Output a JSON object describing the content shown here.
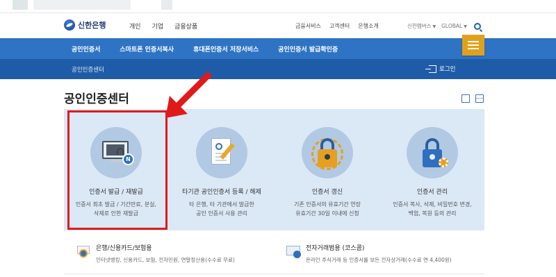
{
  "header": {
    "logo_text": "신한은행",
    "main_nav": [
      "개인",
      "기업",
      "금융상품"
    ],
    "util_nav": [
      "금융서비스",
      "고객센터",
      "은행소개"
    ],
    "family_site": "신한멤버스",
    "global": "GLOBAL"
  },
  "blue_nav": {
    "items": [
      "공인인증서",
      "스마트폰 인증서복사",
      "휴대폰인증서 저장서비스",
      "공인인증서 발급확인증"
    ]
  },
  "sub_nav": {
    "title": "공인인증센터",
    "login_label": "로그인"
  },
  "page": {
    "title": "공인인증센터"
  },
  "cards": [
    {
      "title": "인증서 발급 / 재발급",
      "desc_line1": "인증서 최초 발급 / 기간만료, 분실,",
      "desc_line2": "삭제로 인한 재발급",
      "icon": "monitor-lock-icon"
    },
    {
      "title": "타기관 공인인증서 등록 / 해제",
      "desc_line1": "타 은행, 타 기관에서 발급한",
      "desc_line2": "공인 인증서 사용 관리",
      "icon": "certificate-document-icon"
    },
    {
      "title": "인증서 갱신",
      "desc_line1": "기존 인증서의 유효기간 연장",
      "desc_line2": "유효기간 30일 이내에 신청",
      "icon": "renew-lock-icon"
    },
    {
      "title": "인증서 관리",
      "desc_line1": "인증서 복사, 삭제, 비밀번호 변경,",
      "desc_line2": "백업, 복원 등의 관리",
      "icon": "lock-gear-icon"
    }
  ],
  "bottom": [
    {
      "title": "은행/신용카드/보험용",
      "desc": "인터넷뱅킹, 신용카드, 보험, 전자민원, 연말정산용(수수료 무료)"
    },
    {
      "title": "전자거래범용 (코스콤)",
      "desc": "온라인 주식거래 등 인증서를 보든 전자상거래(수수료 연 4,400원)"
    }
  ],
  "colors": {
    "nav_blue": "#2f74c4",
    "sub_nav_blue": "#1f5ca8",
    "panel": "#dbe8f6",
    "accent_gold": "#e0a21d",
    "highlight_red": "#e01a1a"
  }
}
